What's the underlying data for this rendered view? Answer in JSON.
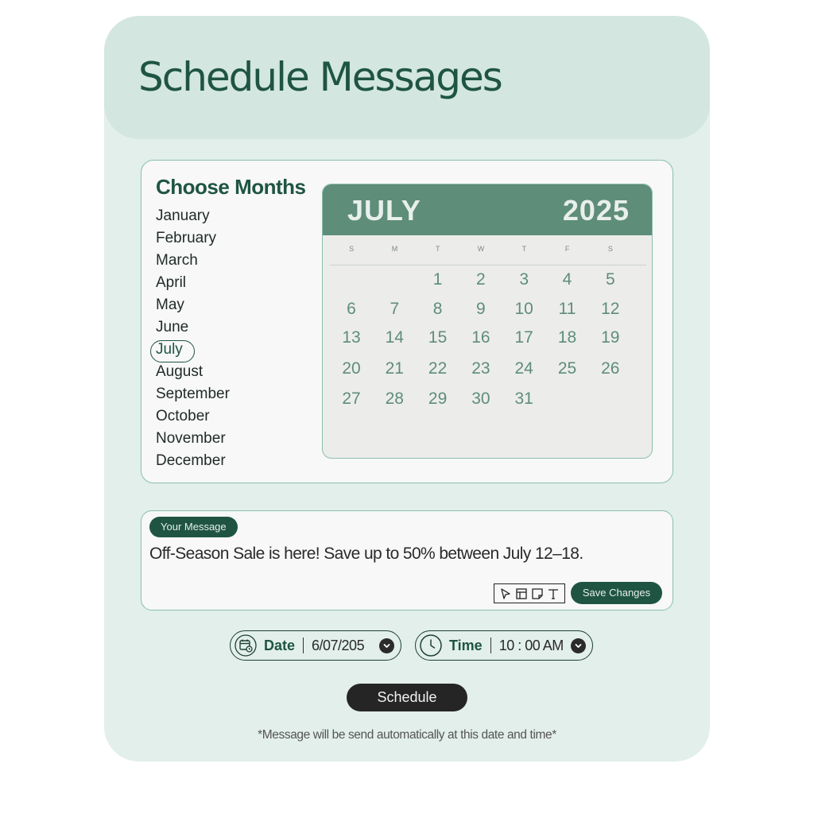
{
  "header": {
    "title": "Schedule Messages"
  },
  "months_panel": {
    "title": "Choose Months",
    "months": [
      "January",
      "February",
      "March",
      "April",
      "May",
      "June",
      "July",
      "August",
      "September",
      "October",
      "November",
      "December"
    ],
    "selected": "July"
  },
  "calendar": {
    "month": "JULY",
    "year": "2025",
    "weekdays": [
      "S",
      "M",
      "T",
      "W",
      "T",
      "F",
      "S"
    ],
    "first_weekday_index": 2,
    "days": [
      "1",
      "2",
      "3",
      "4",
      "5",
      "6",
      "7",
      "8",
      "9",
      "10",
      "11",
      "12",
      "13",
      "14",
      "15",
      "16",
      "17",
      "18",
      "19",
      "20",
      "21",
      "22",
      "23",
      "24",
      "25",
      "26",
      "27",
      "28",
      "29",
      "30",
      "31"
    ]
  },
  "message": {
    "label": "Your Message",
    "text": "Off-Season Sale is here! Save up to 50% between July 12–18.",
    "tools": [
      "cursor-icon",
      "layout-icon",
      "sticky-note-icon",
      "text-icon"
    ],
    "save_label": "Save Changes"
  },
  "date_picker": {
    "label": "Date",
    "value": "6/07/205",
    "icon": "calendar-clock-icon"
  },
  "time_picker": {
    "label": "Time",
    "value": "10 : 00 AM",
    "icon": "clock-icon"
  },
  "schedule_label": "Schedule",
  "footnote": "*Message will be send automatically at this date and time*",
  "colors": {
    "primary": "#1f5443",
    "calendar_header": "#5e8d79",
    "card": "#e2efea",
    "header": "#d3e6e0"
  }
}
